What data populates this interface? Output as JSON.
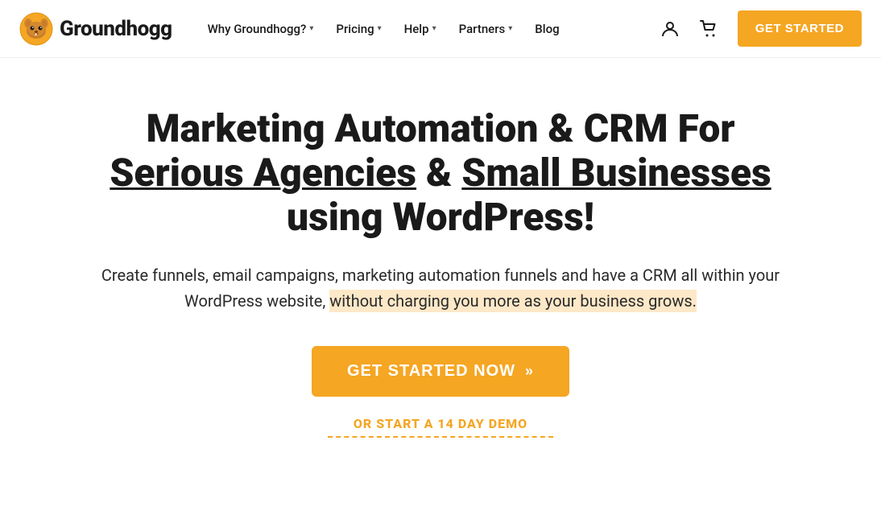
{
  "brand": {
    "name": "Groundhogg",
    "logo_alt": "Groundhogg logo"
  },
  "nav": {
    "links": [
      {
        "label": "Why Groundhogg?",
        "has_dropdown": true
      },
      {
        "label": "Pricing",
        "has_dropdown": true
      },
      {
        "label": "Help",
        "has_dropdown": true
      },
      {
        "label": "Partners",
        "has_dropdown": true
      },
      {
        "label": "Blog",
        "has_dropdown": false
      }
    ],
    "get_started_label": "GET STARTED"
  },
  "hero": {
    "title_part1": "Marketing Automation & CRM For ",
    "title_highlight1": "Serious Agencies",
    "title_part2": " & ",
    "title_highlight2": "Small Businesses",
    "title_part3": " using WordPress!",
    "subtitle_part1": "Create funnels, email campaigns, marketing automation funnels and have a CRM all within your WordPress website, ",
    "subtitle_highlight": "without charging you more as your business grows.",
    "cta_primary": "GET STARTED NOW",
    "cta_arrows": "»",
    "cta_demo": "OR START A 14 DAY DEMO"
  },
  "colors": {
    "orange": "#f5a623",
    "dark": "#1a1a1a",
    "highlight_bg": "#fde8c8"
  }
}
